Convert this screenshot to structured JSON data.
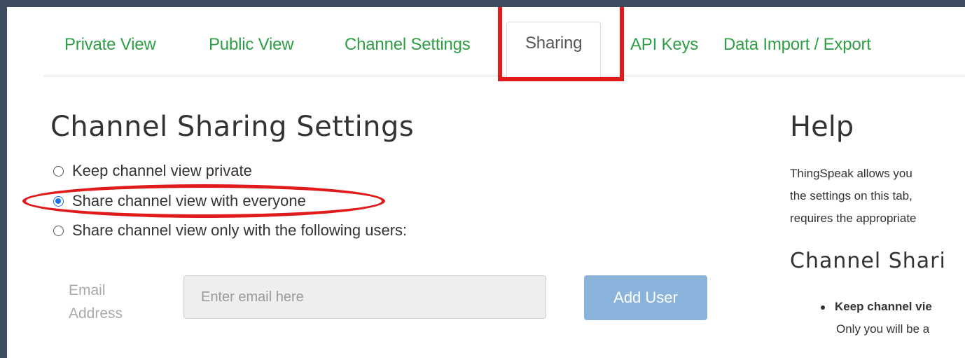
{
  "tabs": [
    {
      "label": "Private View",
      "active": false
    },
    {
      "label": "Public View",
      "active": false
    },
    {
      "label": "Channel Settings",
      "active": false
    },
    {
      "label": "Sharing",
      "active": true
    },
    {
      "label": "API Keys",
      "active": false
    },
    {
      "label": "Data Import / Export",
      "active": false
    }
  ],
  "sharing": {
    "title": "Channel Sharing Settings",
    "options": [
      {
        "label": "Keep channel view private",
        "checked": false
      },
      {
        "label": "Share channel view with everyone",
        "checked": true
      },
      {
        "label": "Share channel view only with the following users:",
        "checked": false
      }
    ],
    "email_label": "Email Address",
    "email_value": "",
    "email_placeholder": "Enter email here",
    "add_button": "Add User"
  },
  "help": {
    "title": "Help",
    "lines": [
      "ThingSpeak allows you",
      "the settings on this tab,",
      "requires the appropriate"
    ],
    "subtitle": "Channel Shari",
    "list": [
      {
        "title": "Keep channel vie",
        "desc": "Only you will be a"
      }
    ]
  },
  "colors": {
    "tab_link": "#2e9e44",
    "annotation": "#e01b1b",
    "button": "#8ab4dc",
    "page_bg": "#3e4c5f"
  }
}
